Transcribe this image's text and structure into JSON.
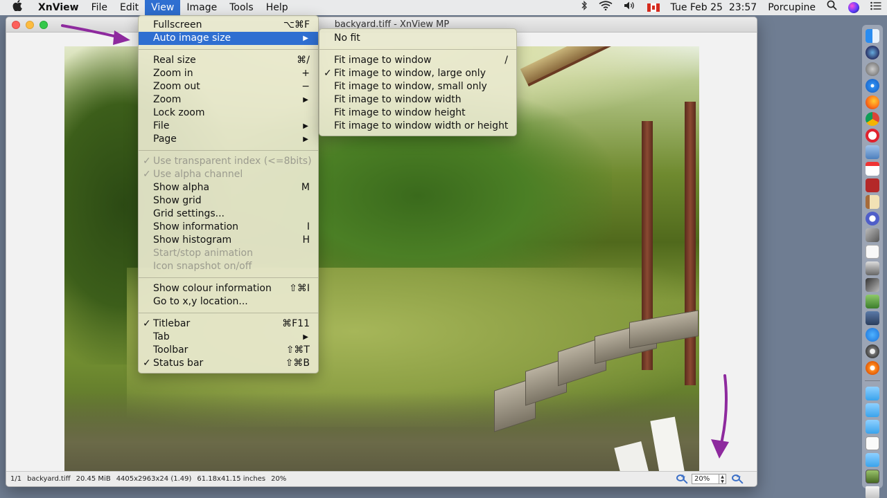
{
  "menubar": {
    "apple": "",
    "app": "XnView",
    "items": [
      "File",
      "Edit",
      "View",
      "Image",
      "Tools",
      "Help"
    ],
    "right": {
      "date": "Tue Feb 25",
      "time": "23:57",
      "user": "Porcupine"
    }
  },
  "window": {
    "title": "backyard.tiff - XnView MP"
  },
  "view_menu": {
    "items": [
      {
        "label": "Fullscreen",
        "shortcut": "⌥⌘F"
      },
      {
        "label": "Auto image size",
        "submenu": true,
        "highlighted": true
      },
      {
        "sep": true
      },
      {
        "label": "Real size",
        "shortcut": "⌘/"
      },
      {
        "label": "Zoom in",
        "shortcut": "+"
      },
      {
        "label": "Zoom out",
        "shortcut": "−"
      },
      {
        "label": "Zoom",
        "submenu": true
      },
      {
        "label": "Lock zoom"
      },
      {
        "label": "File",
        "submenu": true
      },
      {
        "label": "Page",
        "submenu": true
      },
      {
        "sep": true
      },
      {
        "label": "Use transparent index (<=8bits)",
        "checked": true,
        "disabled": true
      },
      {
        "label": "Use alpha channel",
        "checked": true,
        "disabled": true
      },
      {
        "label": "Show alpha",
        "shortcut": "M"
      },
      {
        "label": "Show grid"
      },
      {
        "label": "Grid settings..."
      },
      {
        "label": "Show information",
        "shortcut": "I"
      },
      {
        "label": "Show histogram",
        "shortcut": "H"
      },
      {
        "label": "Start/stop animation",
        "disabled": true
      },
      {
        "label": "Icon snapshot on/off",
        "disabled": true
      },
      {
        "sep": true
      },
      {
        "label": "Show colour information",
        "shortcut": "⇧⌘I"
      },
      {
        "label": "Go to x,y location..."
      },
      {
        "sep": true
      },
      {
        "label": "Titlebar",
        "checked": true,
        "shortcut": "⌘F11"
      },
      {
        "label": "Tab",
        "submenu": true
      },
      {
        "label": "Toolbar",
        "shortcut": "⇧⌘T"
      },
      {
        "label": "Status bar",
        "checked": true,
        "shortcut": "⇧⌘B"
      }
    ]
  },
  "auto_size_submenu": {
    "items": [
      {
        "label": "No fit"
      },
      {
        "sep": true
      },
      {
        "label": "Fit image to window",
        "shortcut": "/"
      },
      {
        "label": "Fit image to window, large only",
        "checked": true
      },
      {
        "label": "Fit image to window, small only"
      },
      {
        "label": "Fit image to window width"
      },
      {
        "label": "Fit image to window height"
      },
      {
        "label": "Fit image to window width or height"
      }
    ]
  },
  "statusbar": {
    "index": "1/1",
    "filename": "backyard.tiff",
    "filesize": "20.45 MiB",
    "dimensions": "4405x2963x24 (1.49)",
    "print_size": "61.18x41.15 inches",
    "zoom": "20%",
    "zoom_field": "20%"
  },
  "colors": {
    "highlight": "#2f6fd1",
    "annotation_arrow": "#8e2a9e",
    "menu_bg": "#e8e8ce"
  }
}
